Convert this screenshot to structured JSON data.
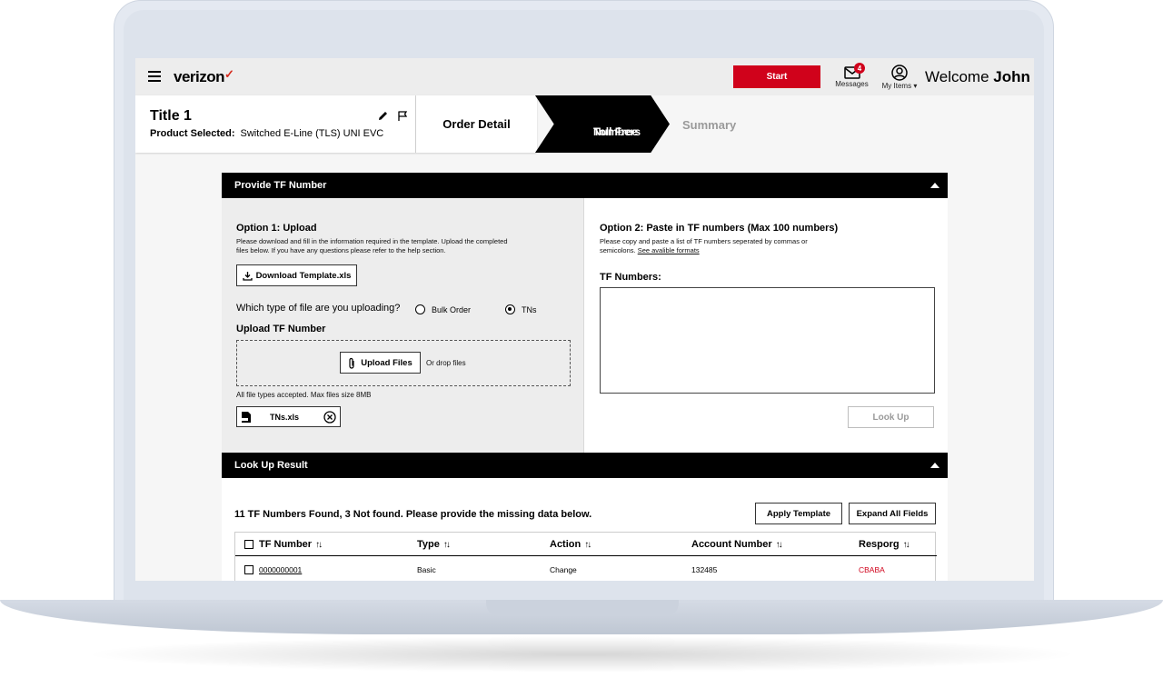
{
  "header": {
    "brand": "verizon",
    "brand_mark": "✓",
    "start_label": "Start",
    "messages_label": "Messages",
    "messages_count": "4",
    "myitems_label": "My Items",
    "welcome_prefix": "Welcome",
    "user_name": "John"
  },
  "order": {
    "title": "Title 1",
    "product_label": "Product Selected:",
    "product_value": "Switched E-Line (TLS) UNI EVC"
  },
  "steps": {
    "step1": "Order Detail",
    "step2_line1": "Toll Free",
    "step2_line2": "Numbers",
    "step3": "Summary"
  },
  "provide": {
    "heading": "Provide TF Number",
    "option1_title": "Option 1: Upload",
    "option1_desc": "Please download and fill in the information required in the template. Upload the completed files below. If you have any questions please refer to the help section.",
    "download_label": "Download Template.xls",
    "file_type_question": "Which type of file are you uploading?",
    "radio_bulk": "Bulk Order",
    "radio_tns": "TNs",
    "upload_heading": "Upload TF Number",
    "upload_button": "Upload Files",
    "drop_text": "Or drop files",
    "file_note": "All file types accepted. Max files size 8MB",
    "file_name": "TNs.xls",
    "option2_title": "Option 2: Paste in TF numbers (Max 100 numbers)",
    "option2_desc": "Please copy and paste a list of TF numbers seperated by commas or semicolons.",
    "formats_link": "See avalible formats",
    "tf_label": "TF Numbers:",
    "tf_value": "",
    "lookup_button": "Look Up"
  },
  "lookup": {
    "heading": "Look Up Result",
    "summary": "11 TF Numbers Found, 3 Not found. Please provide the missing data below.",
    "apply_button": "Apply Template",
    "expand_button": "Expand All Fields",
    "columns": [
      "TF Number",
      "Type",
      "Action",
      "Account Number",
      "Resporg"
    ],
    "rows": [
      {
        "tf_number": "0000000001",
        "type": "Basic",
        "action": "Change",
        "account": "132485",
        "resporg": "CBABA"
      }
    ]
  },
  "colors": {
    "brand_red": "#d0021b",
    "black": "#000000",
    "panel_gray": "#ededed"
  }
}
